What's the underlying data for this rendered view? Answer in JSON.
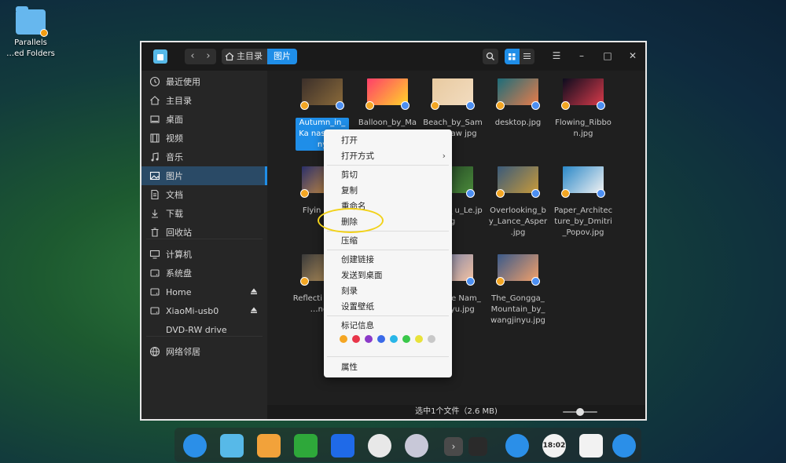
{
  "desktop": {
    "shared_folder_label": "Parallels\n…ed Folders"
  },
  "window": {
    "breadcrumb": {
      "home": "主目录",
      "current": "图片"
    }
  },
  "sidebar": {
    "items": [
      {
        "label": "最近使用",
        "icon": "clock-icon"
      },
      {
        "label": "主目录",
        "icon": "home-icon"
      },
      {
        "label": "桌面",
        "icon": "desktop-icon"
      },
      {
        "label": "视频",
        "icon": "video-icon"
      },
      {
        "label": "音乐",
        "icon": "music-icon"
      },
      {
        "label": "图片",
        "icon": "picture-icon",
        "active": true
      },
      {
        "label": "文档",
        "icon": "document-icon"
      },
      {
        "label": "下载",
        "icon": "download-icon"
      },
      {
        "label": "回收站",
        "icon": "trash-icon"
      },
      {
        "label": "计算机",
        "icon": "computer-icon"
      },
      {
        "label": "系统盘",
        "icon": "disk-icon"
      },
      {
        "label": "Home",
        "icon": "disk-icon",
        "eject": true
      },
      {
        "label": "XiaoMi-usb0",
        "icon": "disk-icon",
        "eject": true
      },
      {
        "label": "DVD-RW drive",
        "icon": ""
      },
      {
        "label": "网络邻居",
        "icon": "network-icon"
      }
    ]
  },
  "files": [
    {
      "name": "Autumn_in_Ka nas_by Jiny",
      "selected": true,
      "colors": [
        "#3b2f2a",
        "#8a6a3a"
      ]
    },
    {
      "name": "Balloon_by_Ma",
      "colors": [
        "#ff3e6a",
        "#ffd42a"
      ]
    },
    {
      "name": "Beach_by_Sam rimshaw jpg",
      "colors": [
        "#e8caa0",
        "#f2dcc0"
      ]
    },
    {
      "name": "desktop.jpg",
      "colors": [
        "#1c6d7a",
        "#e87c4a"
      ]
    },
    {
      "name": "Flowing_Ribbo n.jpg",
      "colors": [
        "#0c0c1e",
        "#d83a4a"
      ]
    },
    {
      "name": "Flyin by_S",
      "colors": [
        "#2a2f6a",
        "#e8a03a"
      ]
    },
    {
      "name": "ngbird_ u_Le.jpg",
      "colors": [
        "#1d3a22",
        "#4a8a3a"
      ]
    },
    {
      "name": "Overlooking_b y_Lance_Asper .jpg",
      "colors": [
        "#3a5a7a",
        "#c89a3a"
      ]
    },
    {
      "name": "Paper_Architec ture_by_Dmitri _Popov.jpg",
      "colors": [
        "#2a88c8",
        "#f2f2f2"
      ]
    },
    {
      "name": "Reflecti he_Kar …ng_J",
      "colors": [
        "#3a3a3a",
        "#caa060"
      ]
    },
    {
      "name": "t_of_the Nam_by inyu.jpg",
      "colors": [
        "#6a7aaa",
        "#f2c0a0"
      ]
    },
    {
      "name": "The_Gongga_ Mountain_by_ wangjinyu.jpg",
      "colors": [
        "#3a5a8a",
        "#f2a06a"
      ]
    }
  ],
  "status": {
    "text": "选中1个文件（2.6 MB)",
    "zoom_level": 0.5
  },
  "context_menu": {
    "items": [
      "打开",
      "打开方式",
      "剪切",
      "复制",
      "重命名",
      "删除",
      "压缩",
      "创建链接",
      "发送到桌面",
      "刻录",
      "设置壁纸",
      "标记信息",
      "属性"
    ],
    "tag_colors": [
      "#f5a623",
      "#e8364a",
      "#8b3ac8",
      "#3a6ae8",
      "#29b6e8",
      "#3ac84a",
      "#e8e23a",
      "#c8c8c8"
    ]
  },
  "dock": {
    "items": [
      "launcher-icon",
      "file-manager-icon",
      "app-store-icon",
      "music-player-icon",
      "video-player-icon",
      "chrome-icon",
      "settings-icon",
      "expand-icon",
      "keyboard-icon",
      "power-icon",
      "clock-icon",
      "trash-icon",
      "shutdown-icon"
    ],
    "clock": "18:02"
  },
  "accent": "#1f8ee8"
}
